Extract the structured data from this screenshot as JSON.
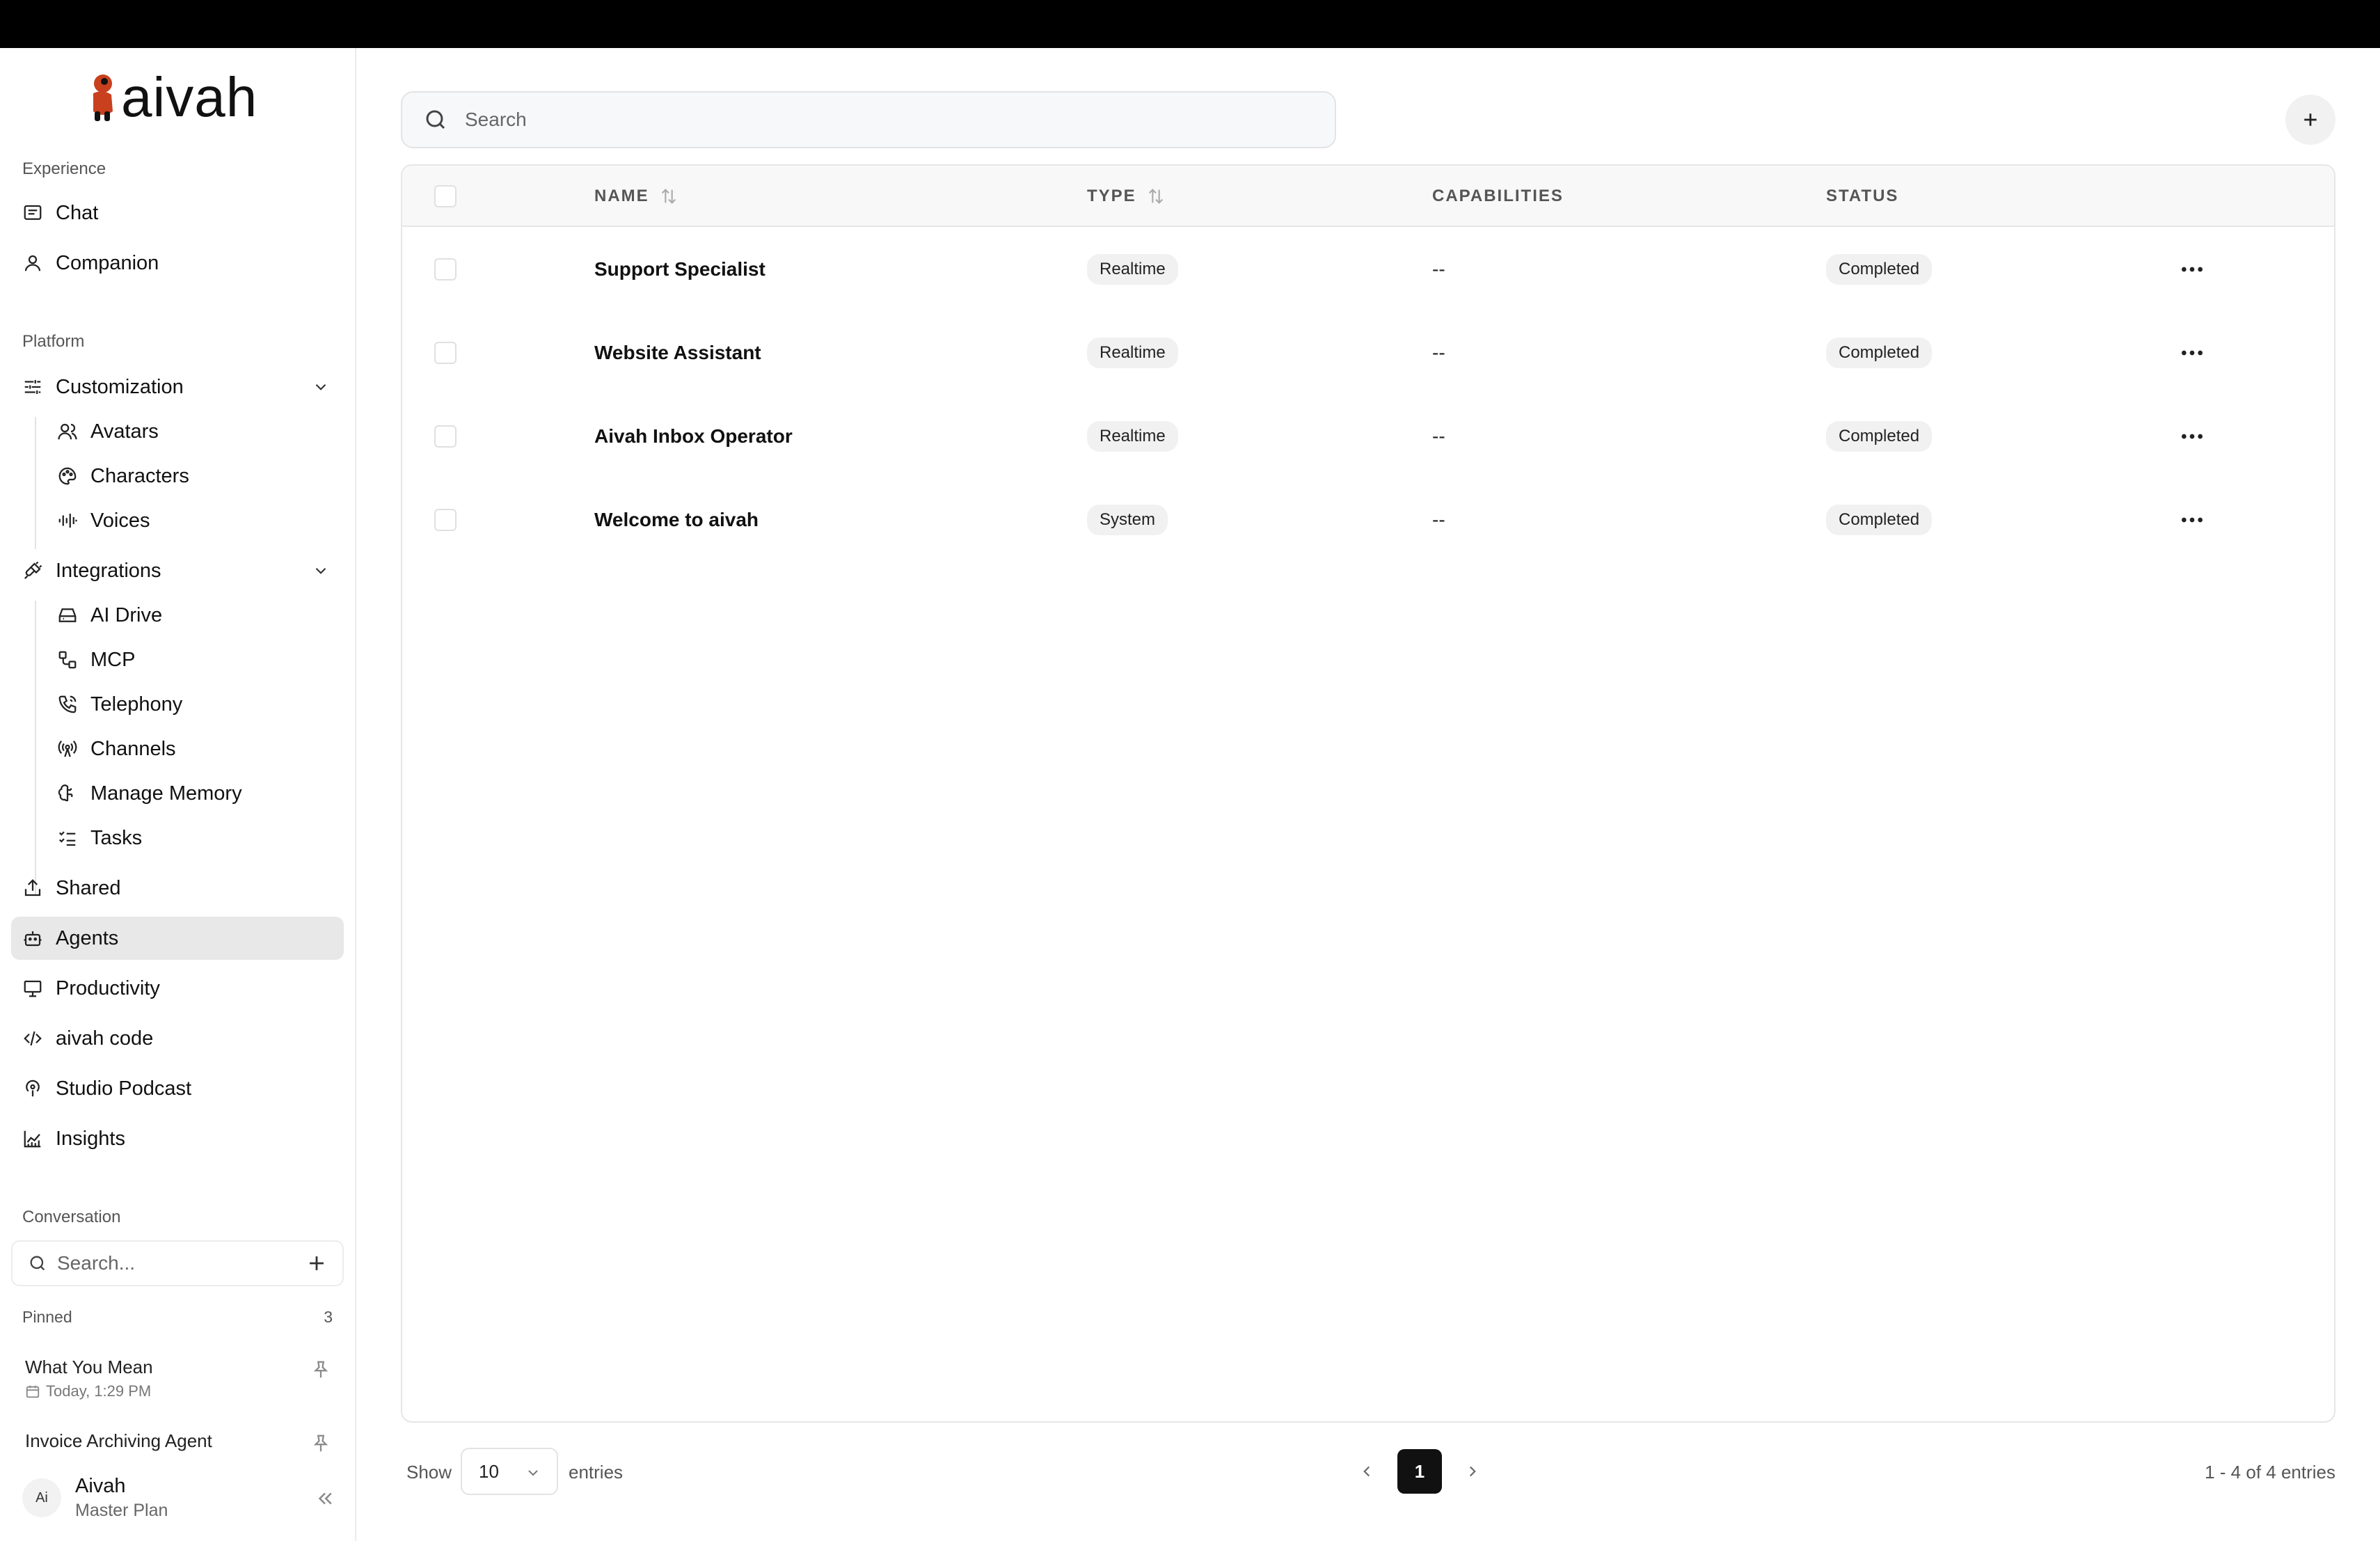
{
  "app": {
    "brand": "aivah"
  },
  "sidebar": {
    "sections": {
      "experience": "Experience",
      "platform": "Platform",
      "conversation": "Conversation"
    },
    "experience_items": [
      {
        "label": "Chat",
        "icon": "chat-icon"
      },
      {
        "label": "Companion",
        "icon": "user-icon"
      }
    ],
    "customization": {
      "label": "Customization",
      "children": [
        {
          "label": "Avatars",
          "icon": "users-icon"
        },
        {
          "label": "Characters",
          "icon": "palette-icon"
        },
        {
          "label": "Voices",
          "icon": "audio-waveform-icon"
        }
      ]
    },
    "integrations": {
      "label": "Integrations",
      "children": [
        {
          "label": "AI Drive",
          "icon": "hard-drive-icon"
        },
        {
          "label": "MCP",
          "icon": "workflow-icon"
        },
        {
          "label": "Telephony",
          "icon": "phone-call-icon"
        },
        {
          "label": "Channels",
          "icon": "radio-tower-icon"
        },
        {
          "label": "Manage Memory",
          "icon": "brain-icon"
        },
        {
          "label": "Tasks",
          "icon": "list-checks-icon"
        }
      ]
    },
    "platform_items": [
      {
        "label": "Shared",
        "icon": "share-icon"
      },
      {
        "label": "Agents",
        "icon": "bot-icon",
        "active": true
      },
      {
        "label": "Productivity",
        "icon": "presentation-icon"
      },
      {
        "label": "aivah code",
        "icon": "code-icon"
      },
      {
        "label": "Studio Podcast",
        "icon": "podcast-icon"
      },
      {
        "label": "Insights",
        "icon": "chart-icon"
      }
    ],
    "conversation_search": {
      "placeholder": "Search..."
    },
    "pinned": {
      "label": "Pinned",
      "count": "3",
      "items": [
        {
          "title": "What You Mean",
          "time": "Today, 1:29 PM"
        },
        {
          "title": "Invoice Archiving Agent",
          "time": ""
        }
      ]
    },
    "user": {
      "initials": "Ai",
      "name": "Aivah",
      "plan": "Master Plan"
    }
  },
  "main": {
    "search": {
      "placeholder": "Search"
    },
    "table": {
      "columns": [
        "NAME",
        "TYPE",
        "CAPABILITIES",
        "STATUS"
      ],
      "rows": [
        {
          "name": "Support Specialist",
          "type": "Realtime",
          "capabilities": "--",
          "status": "Completed"
        },
        {
          "name": "Website Assistant",
          "type": "Realtime",
          "capabilities": "--",
          "status": "Completed"
        },
        {
          "name": "Aivah Inbox Operator",
          "type": "Realtime",
          "capabilities": "--",
          "status": "Completed"
        },
        {
          "name": "Welcome to aivah",
          "type": "System",
          "capabilities": "--",
          "status": "Completed"
        }
      ]
    },
    "footer": {
      "show_label": "Show",
      "page_size": "10",
      "entries_label": "entries",
      "current_page": "1",
      "range": "1 - 4 of 4 entries"
    }
  },
  "colors": {
    "logo_accent": "#c8401e",
    "active_bg": "#e8e8e8",
    "page_active": "#111111"
  }
}
